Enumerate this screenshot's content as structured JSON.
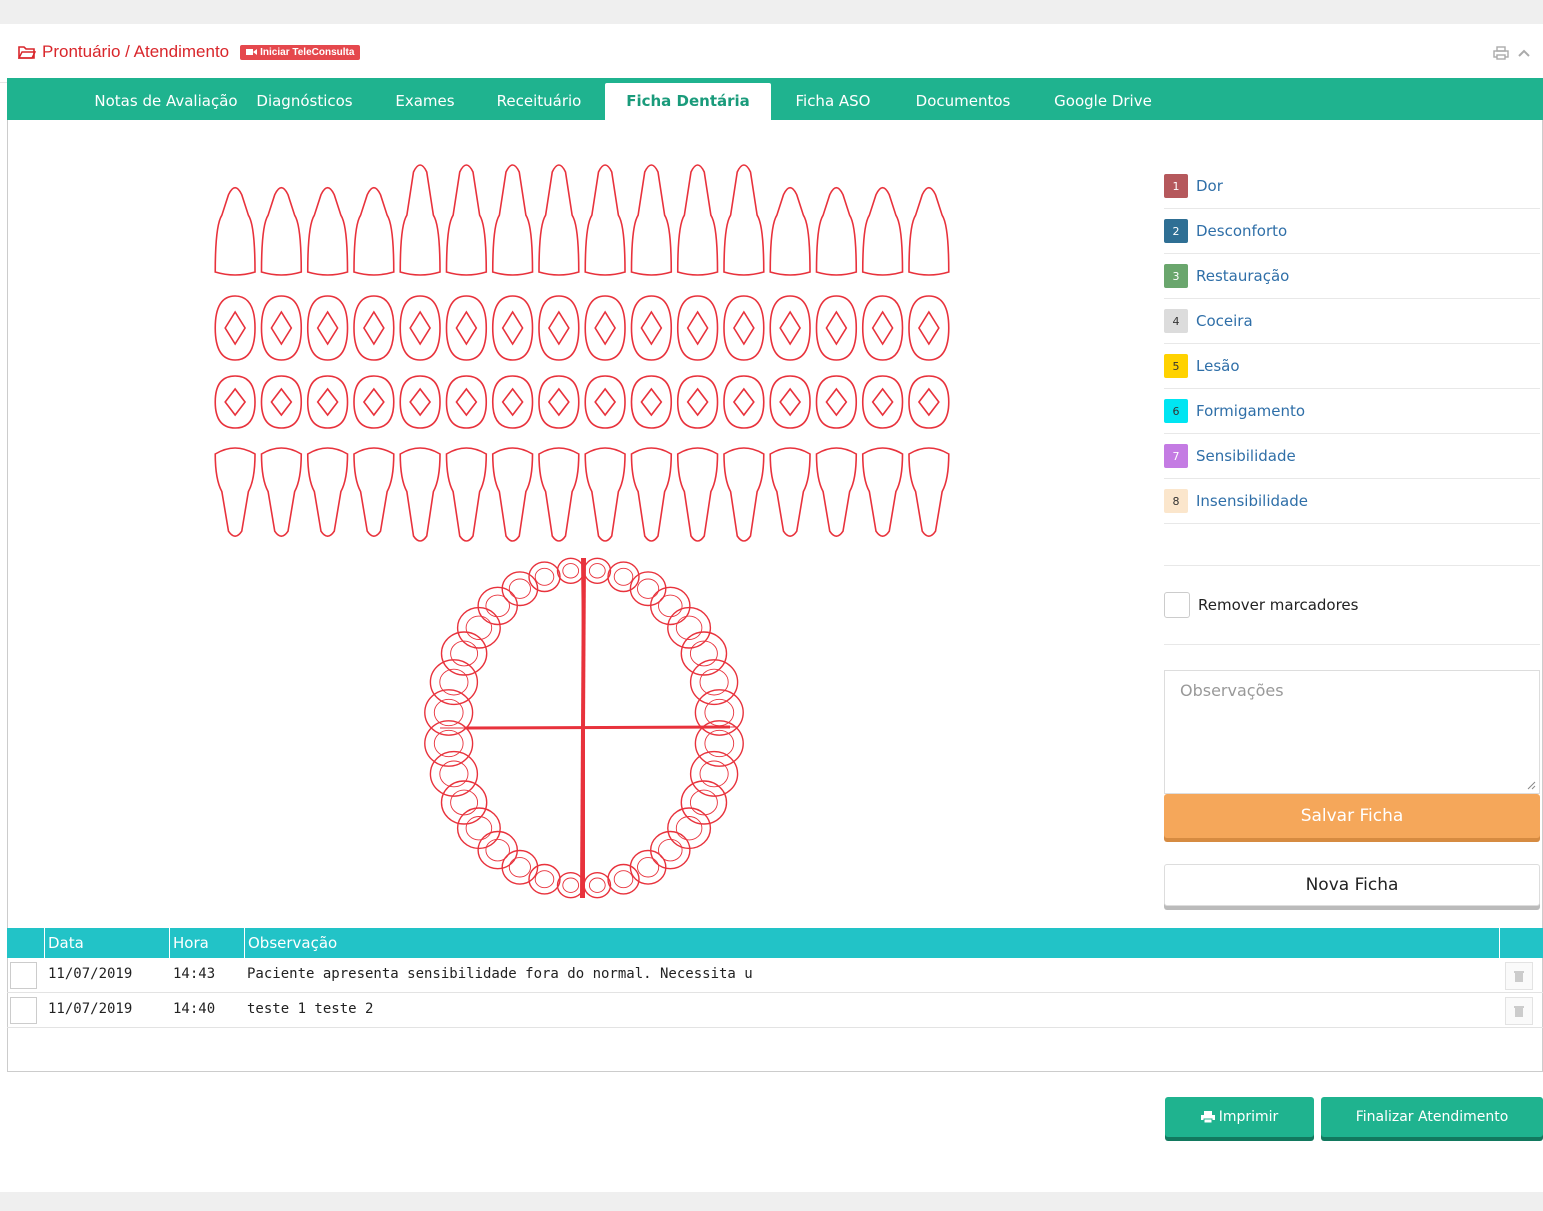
{
  "header": {
    "title": "Prontuário / Atendimento",
    "tele_label": "Iniciar TeleConsulta",
    "icons": [
      "folder-icon",
      "video-icon",
      "print-icon",
      "chevron-up-icon"
    ]
  },
  "tabs": [
    {
      "label": "Notas de Avaliação"
    },
    {
      "label": "Diagnósticos"
    },
    {
      "label": "Exames"
    },
    {
      "label": "Receituário"
    },
    {
      "label": "Ficha Dentária",
      "active": true
    },
    {
      "label": "Ficha ASO"
    },
    {
      "label": "Documentos"
    },
    {
      "label": "Google Drive"
    }
  ],
  "legend": [
    {
      "num": "1",
      "label": "Dor",
      "color": "#b5585c"
    },
    {
      "num": "2",
      "label": "Desconforto",
      "color": "#2f6f94"
    },
    {
      "num": "3",
      "label": "Restauração",
      "color": "#6aa66d"
    },
    {
      "num": "4",
      "label": "Coceira",
      "color": "#dcdcdc"
    },
    {
      "num": "5",
      "label": "Lesão",
      "color": "#ffd200"
    },
    {
      "num": "6",
      "label": "Formigamento",
      "color": "#00e5f2"
    },
    {
      "num": "7",
      "label": "Sensibilidade",
      "color": "#c47be3"
    },
    {
      "num": "8",
      "label": "Insensibilidade",
      "color": "#fbe6cc"
    }
  ],
  "remover_label": "Remover marcadores",
  "observacoes_placeholder": "Observações",
  "salvar_label": "Salvar Ficha",
  "nova_label": "Nova Ficha",
  "table": {
    "headers": {
      "data": "Data",
      "hora": "Hora",
      "obs": "Observação"
    },
    "rows": [
      {
        "data": "11/07/2019",
        "hora": "14:43",
        "obs": "Paciente apresenta sensibilidade fora do normal. Necessita u"
      },
      {
        "data": "11/07/2019",
        "hora": "14:40",
        "obs": "teste 1 teste 2"
      }
    ]
  },
  "footer": {
    "imprimir_label": "Imprimir",
    "finalizar_label": "Finalizar Atendimento"
  },
  "colors": {
    "accent": "#1fb38f",
    "header_red": "#d9262b",
    "tooth_red": "#e8323c",
    "table_head": "#22c3c7",
    "save": "#f5a75a"
  }
}
